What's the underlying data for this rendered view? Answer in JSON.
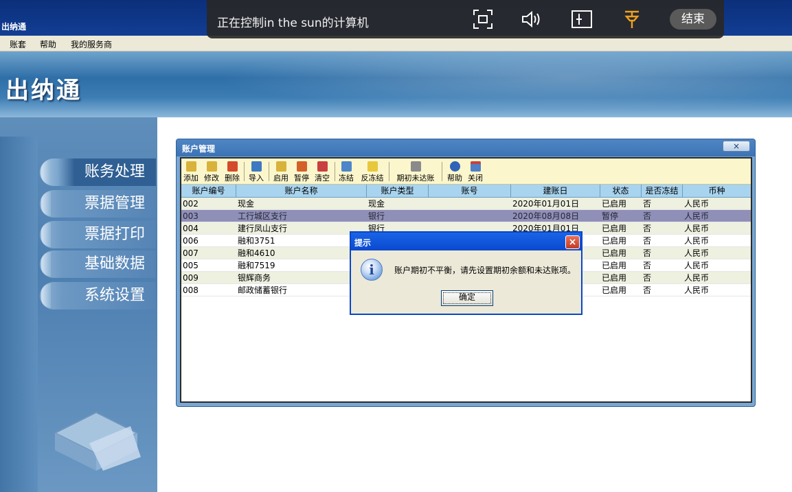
{
  "app": {
    "title": "出纳通"
  },
  "menubar": {
    "items": [
      "账套",
      "帮助",
      "我的服务商"
    ]
  },
  "remote": {
    "label": "正在控制in the sun的计算机",
    "end_label": "结束",
    "icons": [
      "fullscreen-icon",
      "speaker-icon",
      "window-icon",
      "pin-icon"
    ]
  },
  "banner": {
    "title": "出纳通"
  },
  "sidebar": {
    "items": [
      {
        "label": "账务处理",
        "active": true
      },
      {
        "label": "票据管理",
        "active": false
      },
      {
        "label": "票据打印",
        "active": false
      },
      {
        "label": "基础数据",
        "active": false
      },
      {
        "label": "系统设置",
        "active": false
      }
    ]
  },
  "account_window": {
    "title": "账户管理",
    "close_label": "×",
    "toolbar": [
      {
        "label": "添加",
        "icon": "add-icon"
      },
      {
        "label": "修改",
        "icon": "edit-icon"
      },
      {
        "label": "删除",
        "icon": "delete-icon"
      },
      {
        "label": "导入",
        "icon": "import-icon"
      },
      {
        "label": "启用",
        "icon": "enable-icon"
      },
      {
        "label": "暂停",
        "icon": "pause-icon"
      },
      {
        "label": "清空",
        "icon": "clear-icon"
      },
      {
        "label": "冻结",
        "icon": "freeze-icon"
      },
      {
        "label": "反冻结",
        "icon": "unfreeze-icon"
      },
      {
        "label": "期初未达账",
        "icon": "opening-balance-icon"
      },
      {
        "label": "帮助",
        "icon": "help-icon"
      },
      {
        "label": "关闭",
        "icon": "close-window-icon"
      }
    ],
    "columns": [
      "账户编号",
      "账户名称",
      "账户类型",
      "账号",
      "建账日",
      "状态",
      "是否冻结",
      "币种"
    ],
    "rows": [
      [
        "002",
        "现金",
        "现金",
        "",
        "2020年01月01日",
        "已启用",
        "否",
        "人民币"
      ],
      [
        "003",
        "工行城区支行",
        "银行",
        "",
        "2020年08月08日",
        "暂停",
        "否",
        "人民币"
      ],
      [
        "004",
        "建行凤山支行",
        "银行",
        "",
        "2020年01月01日",
        "已启用",
        "否",
        "人民币"
      ],
      [
        "006",
        "融和3751",
        "",
        "",
        "",
        "已启用",
        "否",
        "人民币"
      ],
      [
        "007",
        "融和4610",
        "",
        "",
        "",
        "已启用",
        "否",
        "人民币"
      ],
      [
        "005",
        "融和7519",
        "",
        "",
        "",
        "已启用",
        "否",
        "人民币"
      ],
      [
        "009",
        "银辉商务",
        "",
        "",
        "",
        "已启用",
        "否",
        "人民币"
      ],
      [
        "008",
        "邮政储蓄银行",
        "",
        "",
        "",
        "已启用",
        "否",
        "人民币"
      ]
    ],
    "selected_row": 1
  },
  "alert": {
    "title": "提示",
    "close_label": "×",
    "icon_glyph": "i",
    "message": "账户期初不平衡，请先设置期初余额和未达账项。",
    "ok_label": "确定"
  },
  "colors": {
    "dialog_title": "#0a49cf",
    "selected_row": "#8f8fb8",
    "toolbar_bg": "#fbf6cc",
    "header_bg": "#a8d4ef"
  }
}
